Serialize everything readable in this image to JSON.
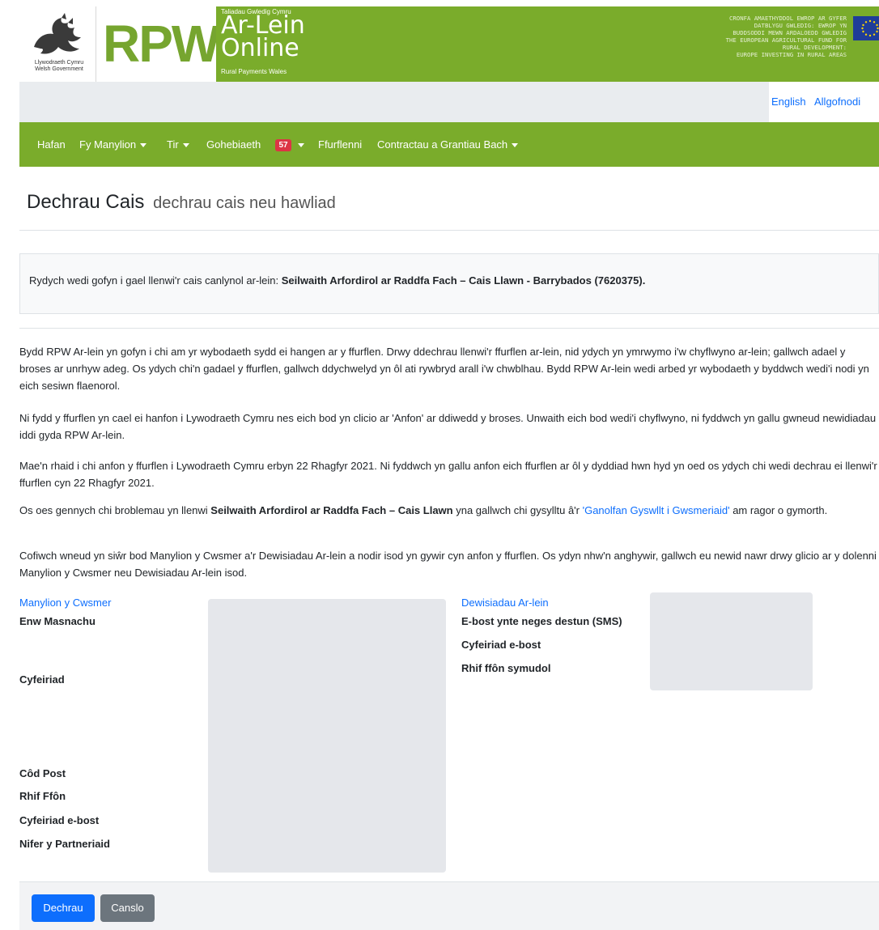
{
  "banner": {
    "gov_name_cy": "Llywodraeth Cymru",
    "gov_name_en": "Welsh Government",
    "rpw": "RPW",
    "sub_top": "Taliadau Gwledig Cymru",
    "title1": "Ar-Lein",
    "title2": "Online",
    "sub_bottom": "Rural Payments Wales",
    "eu_lines": [
      "CRONFA AMAETHYDDOL EWROP AR GYFER",
      "DATBLYGU GWLEDIG: EWROP YN",
      "BUDDSODDI MEWN ARDALOEDD GWLEDIG",
      "THE EUROPEAN AGRICULTURAL FUND FOR",
      "RURAL DEVELOPMENT:",
      "EUROPE INVESTING IN RURAL AREAS"
    ]
  },
  "topbar": {
    "language_link": "English",
    "logout_link": "Allgofnodi"
  },
  "nav": {
    "home": "Hafan",
    "my_details": "Fy Manylion",
    "land": "Tir",
    "correspondence": "Gohebiaeth",
    "correspondence_count": "57",
    "forms": "Ffurflenni",
    "contracts": "Contractau a Grantiau Bach"
  },
  "page": {
    "title": "Dechrau Cais",
    "subtitle": "dechrau cais neu hawliad"
  },
  "alert": {
    "prefix": "Rydych wedi gofyn i gael llenwi'r cais canlynol ar-lein: ",
    "application": "Seilwaith Arfordirol ar Raddfa Fach – Cais Llawn - Barrybados (7620375)."
  },
  "paragraphs": {
    "p1": "Bydd RPW Ar-lein yn gofyn i chi am yr wybodaeth sydd ei hangen ar y ffurflen. Drwy ddechrau llenwi'r ffurflen ar-lein, nid ydych yn ymrwymo i'w chyflwyno ar-lein; gallwch adael y broses ar unrhyw adeg. Os ydych chi'n gadael y ffurflen, gallwch ddychwelyd yn ôl ati rywbryd arall i'w chwblhau. Bydd RPW Ar-lein wedi arbed yr wybodaeth y byddwch wedi'i nodi yn eich sesiwn flaenorol.",
    "p2": "Ni fydd y ffurflen yn cael ei hanfon i Lywodraeth Cymru nes eich bod yn clicio ar 'Anfon' ar ddiwedd y broses. Unwaith eich bod wedi'i chyflwyno, ni fyddwch yn gallu gwneud newidiadau iddi gyda RPW Ar-lein.",
    "p3": "Mae'n rhaid i chi anfon y ffurflen i Lywodraeth Cymru erbyn 22 Rhagfyr 2021. Ni fyddwch yn gallu anfon eich ffurflen ar ôl y dyddiad hwn hyd yn oed os ydych chi wedi dechrau ei llenwi'r ffurflen cyn 22 Rhagfyr 2021.",
    "p4_a": "Os oes gennych chi broblemau yn llenwi ",
    "p4_b": "Seilwaith Arfordirol ar Raddfa Fach – Cais Llawn",
    "p4_c": " yna gallwch chi gysylltu â'r ",
    "p4_link": "'Ganolfan Gyswllt i Gwsmeriaid'",
    "p4_d": " am ragor o gymorth.",
    "p5": "Cofiwch wneud yn siŵr bod Manylion y Cwsmer a'r Dewisiadau Ar-lein a nodir isod yn gywir cyn anfon y ffurflen. Os ydyn nhw'n anghywir, gallwch eu newid nawr drwy glicio ar y dolenni Manylion y Cwsmer neu Dewisiadau Ar-lein isod."
  },
  "customer": {
    "link": "Manylion y Cwsmer",
    "trading_name": "Enw Masnachu",
    "address": "Cyfeiriad",
    "postcode": "Côd Post",
    "phone": "Rhif Ffôn",
    "email": "Cyfeiriad e-bost",
    "partners": "Nifer y Partneriaid"
  },
  "preferences": {
    "link": "Dewisiadau Ar-lein",
    "email_or_sms": "E-bost ynte neges destun (SMS)",
    "email": "Cyfeiriad e-bost",
    "mobile": "Rhif ffôn symudol"
  },
  "footer": {
    "start": "Dechrau",
    "cancel": "Canslo"
  },
  "colors": {
    "brand_green": "#7aac2b",
    "primary": "#0d6efd",
    "secondary": "#6c757d",
    "badge": "#dc3545"
  }
}
